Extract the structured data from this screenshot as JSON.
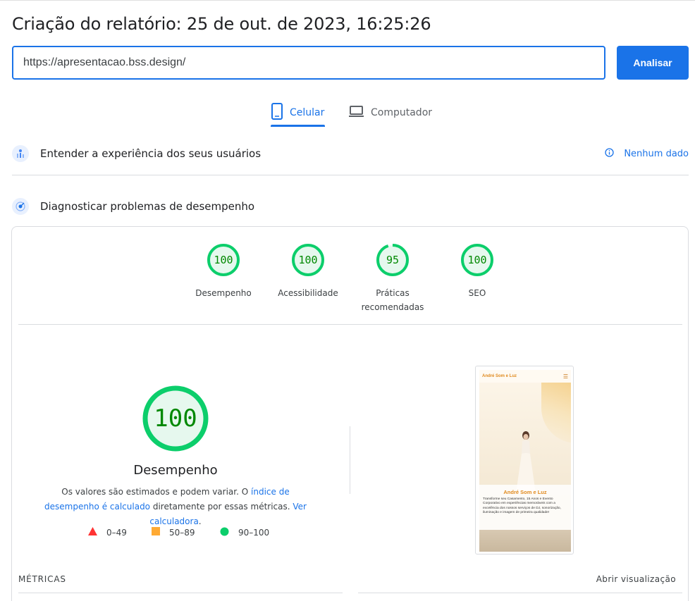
{
  "header": {
    "title": "Criação do relatório: 25 de out. de 2023, 16:25:26"
  },
  "search": {
    "url_value": "https://apresentacao.bss.design/",
    "analyze_label": "Analisar"
  },
  "tabs": [
    {
      "label": "Celular",
      "icon": "smartphone-icon",
      "active": true
    },
    {
      "label": "Computador",
      "icon": "laptop-icon",
      "active": false
    }
  ],
  "crux": {
    "label": "Entender a experiência dos seus usuários",
    "icon": "users-chart-icon",
    "no_data_label": "Nenhum dado"
  },
  "diagnose": {
    "label": "Diagnosticar problemas de desempenho",
    "icon": "lighthouse-icon"
  },
  "scores": [
    {
      "value": "100",
      "score": 1.0,
      "label": "Desempenho"
    },
    {
      "value": "100",
      "score": 1.0,
      "label": "Acessibilidade"
    },
    {
      "value": "95",
      "score": 0.95,
      "label": "Práticas recomendadas"
    },
    {
      "value": "100",
      "score": 1.0,
      "label": "SEO"
    }
  ],
  "performance": {
    "score": "100",
    "score_fraction": 1.0,
    "title": "Desempenho",
    "desc_prefix": "Os valores são estimados e podem variar. O ",
    "desc_link1": "índice de desempenho é calculado",
    "desc_middle": " diretamente por essas métricas. ",
    "desc_link2": "Ver calculadora",
    "desc_suffix": "."
  },
  "legend": [
    {
      "shape": "triangle",
      "range": "0–49",
      "color": "#ff3333"
    },
    {
      "shape": "square",
      "range": "50–89",
      "color": "#ffaa33"
    },
    {
      "shape": "circle",
      "range": "90–100",
      "color": "#0cce6b"
    }
  ],
  "preview": {
    "brand": "André Som e Luz",
    "caption_title": "André Som e Luz",
    "caption_text": "Transforme seu Casamento, 15 Anos e Evento Corporativo em experiências memoráveis com a excelência dos nossos serviços de DJ, sonorização, iluminação e imagem de primeira qualidade!"
  },
  "metrics": {
    "title": "MÉTRICAS",
    "open_view": "Abrir visualização"
  },
  "colors": {
    "accent": "#1a73e8",
    "pass": "#0cce6b",
    "pass_text": "#008800",
    "pass_fill": "#e6f8ee"
  }
}
